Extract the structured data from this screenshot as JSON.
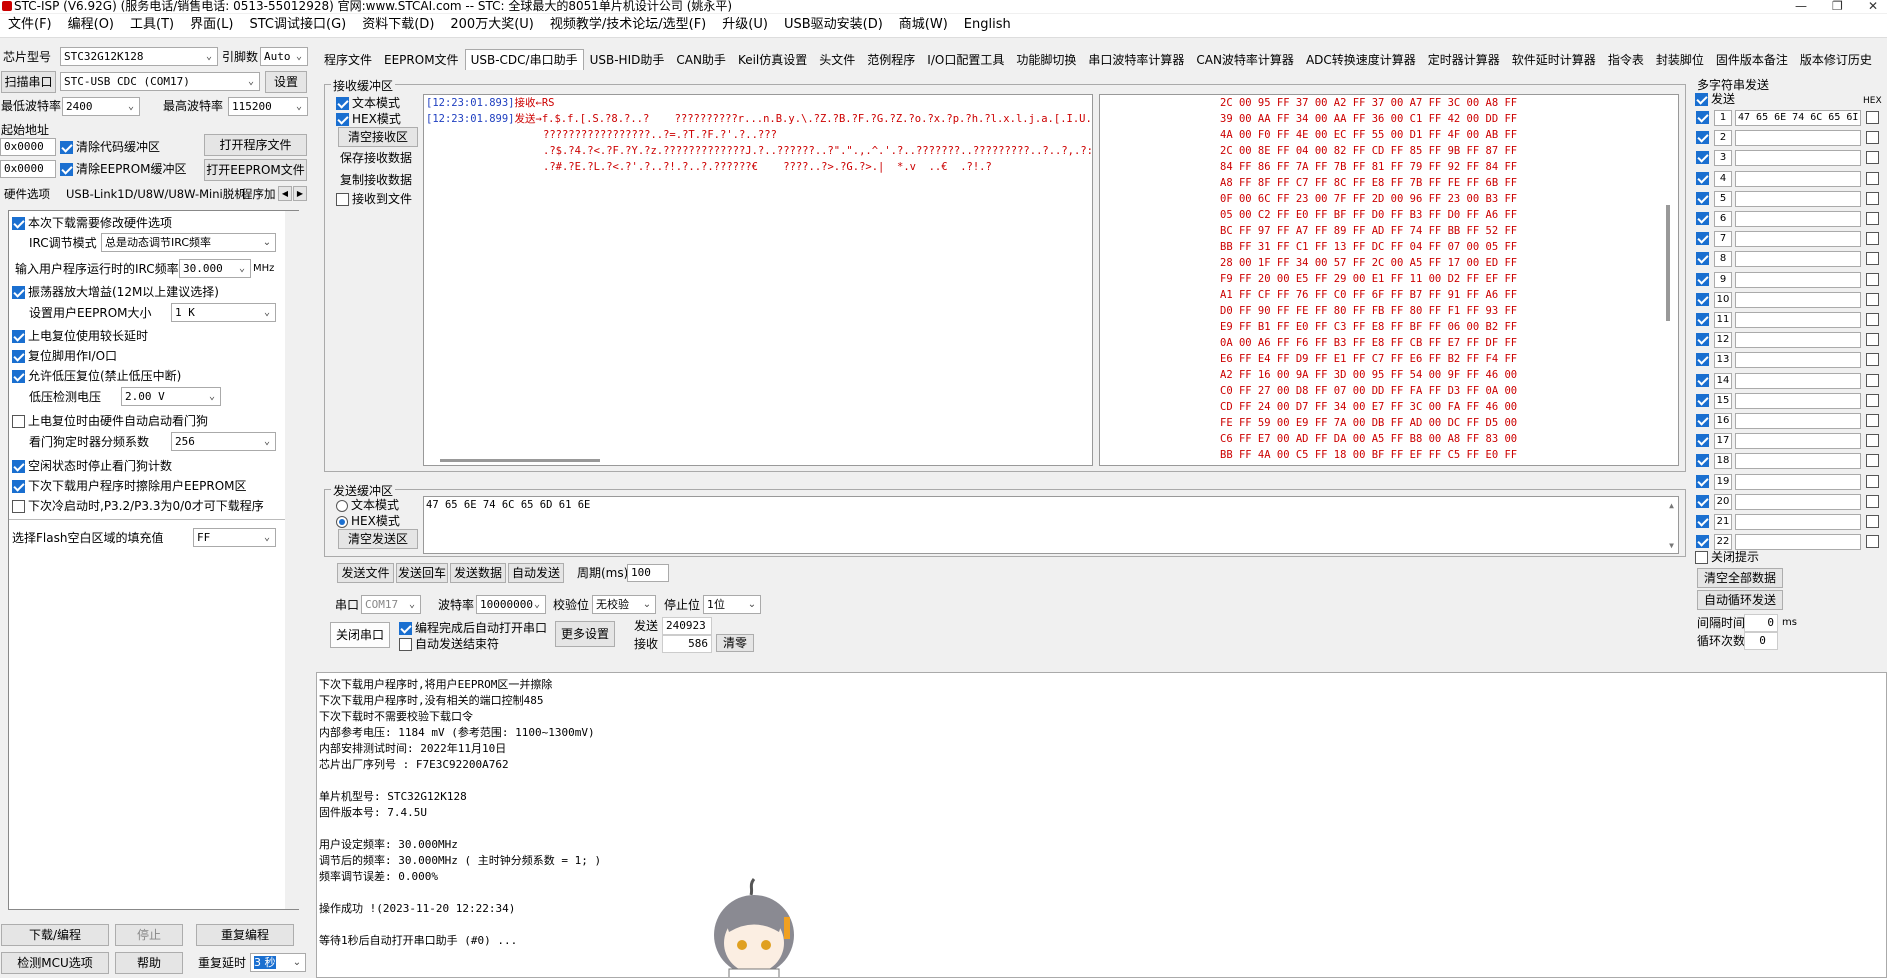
{
  "window": {
    "title": "STC-ISP (V6.92G) (服务电话/销售电话: 0513-55012928) 官网:www.STCAI.com  -- STC: 全球最大的8051单片机设计公司 (姚永平)"
  },
  "menu": [
    "文件(F)",
    "编程(O)",
    "工具(T)",
    "界面(L)",
    "STC调试接口(G)",
    "资料下载(D)",
    "200万大奖(U)",
    "视频教学/技术论坛/选型(F)",
    "升级(U)",
    "USB驱动安装(D)",
    "商城(W)",
    "English"
  ],
  "left": {
    "chip_label": "芯片型号",
    "chip_value": "STC32G12K128",
    "pins_label": "引脚数",
    "pins_value": "Auto",
    "scan_button": "扫描串口",
    "port_value": "STC-USB CDC (COM17)",
    "settings_button": "设置",
    "min_baud_label": "最低波特率",
    "min_baud_value": "2400",
    "max_baud_label": "最高波特率",
    "max_baud_value": "115200",
    "start_addr_label": "起始地址",
    "addr1": "0x0000",
    "clear_code_label": "清除代码缓冲区",
    "open_prog_button": "打开程序文件",
    "addr2": "0x0000",
    "clear_eeprom_label": "清除EEPROM缓冲区",
    "open_eeprom_button": "打开EEPROM文件",
    "subtabs": [
      "硬件选项",
      "USB-Link1D/U8W/U8W-Mini脱机",
      "程序加"
    ],
    "options": {
      "o1": "本次下载需要修改硬件选项",
      "irc_mode_label": "IRC调节模式",
      "irc_mode_value": "总是动态调节IRC频率",
      "irc_freq_label": "输入用户程序运行时的IRC频率",
      "irc_freq_value": "30.000",
      "irc_freq_unit": "MHz",
      "o2": "振荡器放大增益(12M以上建议选择)",
      "eeprom_size_label": "设置用户EEPROM大小",
      "eeprom_size_value": "1   K",
      "o3": "上电复位使用较长延时",
      "o4": "复位脚用作I/O口",
      "o5": "允许低压复位(禁止低压中断)",
      "lv_label": "低压检测电压",
      "lv_value": "2.00 V",
      "o6": "上电复位时由硬件自动启动看门狗",
      "wdt_label": "看门狗定时器分频系数",
      "wdt_value": "256",
      "o7": "空闲状态时停止看门狗计数",
      "o8": "下次下载用户程序时擦除用户EEPROM区",
      "o9": "下次冷启动时,P3.2/P3.3为0/0才可下载程序",
      "fill_label": "选择Flash空白区域的填充值",
      "fill_value": "FF"
    },
    "download_button": "下载/编程",
    "stop_button": "停止",
    "reprogram_button": "重复编程",
    "detect_button": "检测MCU选项",
    "help_button": "帮助",
    "repeat_delay_label": "重复延时",
    "repeat_delay_value": "3 秒"
  },
  "tabs": [
    "程序文件",
    "EEPROM文件",
    "USB-CDC/串口助手",
    "USB-HID助手",
    "CAN助手",
    "Keil仿真设置",
    "头文件",
    "范例程序",
    "I/O口配置工具",
    "功能脚切换",
    "串口波特率计算器",
    "CAN波特率计算器",
    "ADC转换速度计算器",
    "定时器计算器",
    "软件延时计算器",
    "指令表",
    "封装脚位",
    "固件版本备注",
    "版本修订历史"
  ],
  "recv": {
    "title": "接收缓冲区",
    "text_mode": "文本模式",
    "hex_mode": "HEX模式",
    "clear_button": "清空接收区",
    "save_button": "保存接收数据",
    "copy_button": "复制接收数据",
    "to_file": "接收到文件",
    "line1_time": "[12:23:01.893]",
    "line1_rest": "接收←RS",
    "line2_time": "[12:23:01.899]",
    "line2_rest": "发送→f.$.f.[.S.?8.?..?    ??????????r...n.B.y.\\.?Z.?B.?F.?G.?Z.?o.?x.?p.?h.?l.x.l.j.a.[.I.U.O.S.",
    "line3": "?????????????????..?=.?T.?F.?'.?..???",
    "line4": ".?$.?4.?<.?F.?Y.?z.?????????????J.?..??????..?\".\".,.^.'.?..???????..?????????..?..?,.?:.?6.'",
    "line5": ".?#.?E.?L.?<.?'.?..?!.?..?.??????€    ????..?>.?G.?>.|  *.v  ..€  .?!.?",
    "hex_lines": [
      "2C 00 95 FF 37 00 A2 FF 37 00 A7 FF 3C 00 A8 FF",
      "39 00 AA FF 34 00 AA FF 36 00 C1 FF 42 00 DD FF",
      "4A 00 F0 FF 4E 00 EC FF 55 00 D1 FF 4F 00 AB FF",
      "2C 00 8E FF 04 00 82 FF CD FF 85 FF 9B FF 87 FF",
      "84 FF 86 FF 7A FF 7B FF 81 FF 79 FF 92 FF 84 FF",
      "A8 FF 8F FF C7 FF 8C FF E8 FF 7B FF FE FF 6B FF",
      "0F 00 6C FF 23 00 7F FF 2D 00 96 FF 23 00 B3 FF",
      "05 00 C2 FF E0 FF BF FF D0 FF B3 FF D0 FF A6 FF",
      "BC FF 97 FF A7 FF 89 FF AD FF 74 FF BB FF 52 FF",
      "BB FF 31 FF C1 FF 13 FF DC FF 04 FF 07 00 05 FF",
      "28 00 1F FF 34 00 57 FF 2C 00 A5 FF 17 00 ED FF",
      "F9 FF 20 00 E5 FF 29 00 E1 FF 11 00 D2 FF EF FF",
      "A1 FF CF FF 76 FF C0 FF 6F FF B7 FF 91 FF A6 FF",
      "D0 FF 90 FF FE FF 80 FF FB FF 80 FF F1 FF 93 FF",
      "E9 FF B1 FF E0 FF C3 FF E8 FF BF FF 06 00 B2 FF",
      "0A 00 A6 FF F6 FF B3 FF E8 FF CB FF E7 FF DF FF",
      "E6 FF E4 FF D9 FF E1 FF C7 FF E6 FF B2 FF F4 FF",
      "A2 FF 16 00 9A FF 3D 00 95 FF 54 00 9F FF 46 00",
      "C0 FF 27 00 D8 FF 07 00 DD FF FA FF D3 FF 0A 00",
      "CD FF 24 00 D7 FF 34 00 E7 FF 3C 00 FA FF 46 00",
      "FE FF 59 00 E9 FF 7A 00 DB FF AD 00 DC FF D5 00",
      "C6 FF E7 00 AD FF DA 00 A5 FF B8 00 A8 FF 83 00",
      "BB FF 4A 00 C5 FF 18 00 BF FF EF FF C5 FF E0 FF"
    ]
  },
  "send": {
    "title": "发送缓冲区",
    "text_mode": "文本模式",
    "hex_mode": "HEX模式",
    "clear_button": "清空发送区",
    "content": "47 65 6E 74 6C 65 6D 61 6E",
    "send_file": "发送文件",
    "send_return": "发送回车",
    "send_data": "发送数据",
    "auto_send": "自动发送",
    "period_label": "周期(ms)",
    "period_value": "100"
  },
  "serial": {
    "port_label": "串口",
    "port_value": "COM17",
    "baud_label": "波特率",
    "baud_value": "10000000",
    "parity_label": "校验位",
    "parity_value": "无校验",
    "stop_label": "停止位",
    "stop_value": "1位",
    "close_button": "关闭串口",
    "auto_open": "编程完成后自动打开串口",
    "auto_end": "自动发送结束符",
    "more_button": "更多设置",
    "sent_label": "发送",
    "sent_value": "240923",
    "recv_label": "接收",
    "recv_value": "586",
    "clear_button": "清零"
  },
  "multi": {
    "title": "多字符串发送",
    "send_header": "发送",
    "hex_header": "HEX",
    "first_value": "47 65 6E 74 6C 65 6I",
    "numbers": [
      "1",
      "2",
      "3",
      "4",
      "5",
      "6",
      "7",
      "8",
      "9",
      "10",
      "11",
      "12",
      "13",
      "14",
      "15",
      "16",
      "17",
      "18",
      "19",
      "20",
      "21",
      "22"
    ],
    "close_tip": "关闭提示",
    "clear_all": "清空全部数据",
    "auto_loop": "自动循环发送",
    "interval_label": "间隔时间",
    "interval_value": "0",
    "interval_unit": "ms",
    "loop_label": "循环次数",
    "loop_value": "0"
  },
  "log": [
    "  下次下载用户程序时,将用户EEPROM区一并擦除",
    "  下次下载用户程序时,没有相关的端口控制485",
    "  下次下载时不需要校验下载口令",
    "  内部参考电压: 1184 mV (参考范围: 1100~1300mV)",
    "  内部安排测试时间: 2022年11月10日",
    "芯片出厂序列号 : F7E3C92200A762",
    "",
    "  单片机型号: STC32G12K128",
    "  固件版本号: 7.4.5U",
    "",
    "  用户设定频率: 30.000MHz",
    "  调节后的频率: 30.000MHz ( 主时钟分频系数 = 1; )",
    "  频率调节误差: 0.000%",
    "",
    "操作成功 !(2023-11-20 12:22:34)",
    "",
    "等待1秒后自动打开串口助手 (#0) ..."
  ]
}
